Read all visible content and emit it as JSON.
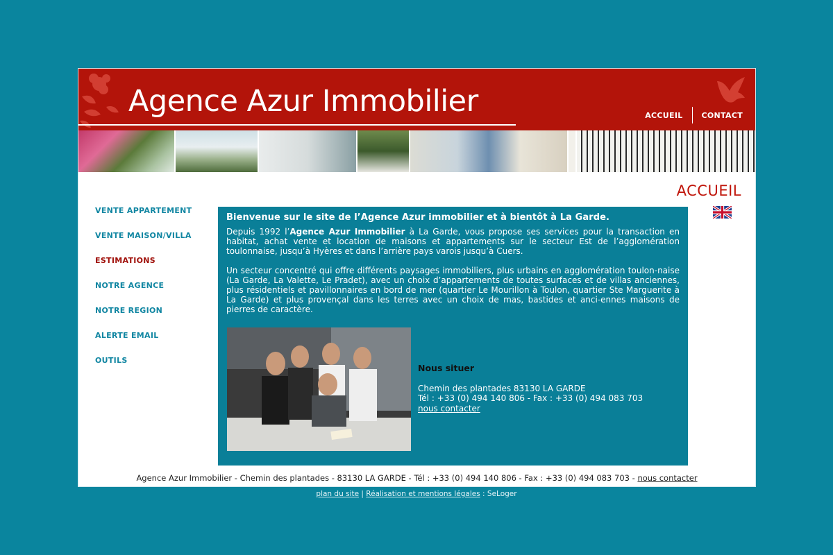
{
  "header": {
    "logo_text": "Agence Azur Immobilier",
    "nav": [
      "ACCUEIL",
      "CONTACT"
    ]
  },
  "page_heading": "ACCUEIL",
  "sidenav": [
    {
      "label": "VENTE APPARTEMENT",
      "active": false
    },
    {
      "label": "VENTE MAISON/VILLA",
      "active": false
    },
    {
      "label": "ESTIMATIONS",
      "active": true
    },
    {
      "label": "NOTRE AGENCE",
      "active": false
    },
    {
      "label": "NOTRE REGION",
      "active": false
    },
    {
      "label": "ALERTE EMAIL",
      "active": false
    },
    {
      "label": "OUTILS",
      "active": false
    }
  ],
  "content": {
    "title": "Bienvenue sur le site de l’Agence Azur immobilier et à bientôt à La Garde.",
    "p1_before": "Depuis 1992 l’",
    "p1_bold": "Agence Azur Immobilier",
    "p1_after": " à La Garde, vous propose ses services pour la transaction en habitat, achat vente et location de maisons et appartements sur le secteur Est de l’agglomération toulonnaise, jusqu’à Hyères et dans l’arrière pays varois jusqu’à Cuers.",
    "p2": "Un secteur concentré qui offre différents paysages immobiliers, plus urbains en agglomération toulon-naise (La Garde, La Valette, Le Pradet), avec un choix d’appartements de toutes surfaces et de villas anciennes, plus résidentiels et pavillonnaires en bord de mer (quartier Le Mourillon à Toulon, quartier Ste Marguerite à La Garde) et plus provençal dans les terres avec un choix de mas, bastides et anci-ennes maisons de pierres de caractère.",
    "locate": {
      "title": "Nous situer",
      "address": "Chemin des plantades 83130 LA GARDE",
      "phone_fax": "Tél : +33 (0) 494 140 806 - Fax : +33 (0) 494 083 703",
      "contact_link": "nous contacter"
    }
  },
  "footer": {
    "text": "Agence Azur Immobilier - Chemin des plantades - 83130 LA GARDE - Tél : +33 (0) 494 140 806 - Fax : +33 (0) 494 083 703 - ",
    "contact_link": "nous contacter"
  },
  "bottom_links": {
    "sitemap": "plan du site",
    "separator": "|",
    "legal": "Réalisation et mentions légales",
    "suffix": ": SeLoger"
  },
  "colors": {
    "background": "#0a859e",
    "header_red": "#b3140a",
    "content_teal": "#0a7f98",
    "nav_teal": "#1186a2",
    "nav_active": "#a0100a"
  },
  "icons": [
    "rose-decoration",
    "bird-decoration",
    "uk-flag-icon"
  ]
}
